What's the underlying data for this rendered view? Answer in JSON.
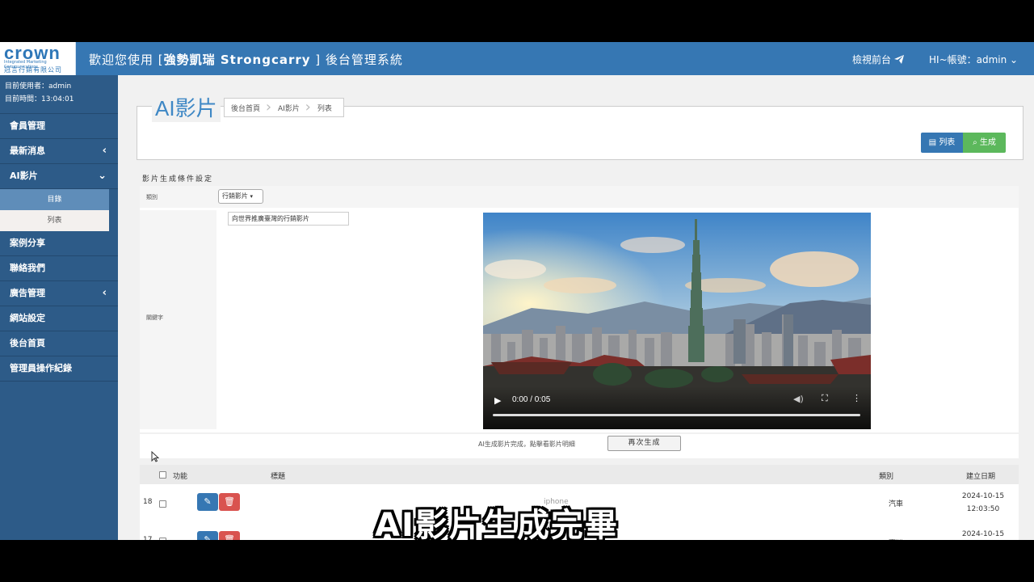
{
  "header": {
    "logo_text": "crown",
    "logo_sub_en": "Integrated Marketing Communications",
    "logo_sub_zh": "冠言行銷有限公司",
    "welcome_prefix": "歡迎您使用 [",
    "brand": "強勢凱瑞 Strongcarry",
    "welcome_suffix": " ] 後台管理系統",
    "view_front_label": "檢視前台",
    "account_label": "HI~帳號：admin",
    "accent_color": "#3677b3"
  },
  "sidebar": {
    "user_info": "目前使用者：admin",
    "time_info": "目前時間：13:04:01",
    "items": [
      {
        "label": "會員管理",
        "chevron": ""
      },
      {
        "label": "最新消息",
        "chevron": "‹"
      },
      {
        "label": "AI影片",
        "chevron": "⌄"
      },
      {
        "label": "案例分享",
        "chevron": ""
      },
      {
        "label": "聯絡我們",
        "chevron": ""
      },
      {
        "label": "廣告管理",
        "chevron": "‹"
      },
      {
        "label": "網站設定",
        "chevron": ""
      },
      {
        "label": "後台首頁",
        "chevron": ""
      },
      {
        "label": "管理員操作紀錄",
        "chevron": ""
      }
    ],
    "submenu": [
      {
        "label": "目錄"
      },
      {
        "label": "列表"
      }
    ],
    "collapse_icon": "‹"
  },
  "page": {
    "title": "AI影片",
    "breadcrumb": [
      "後台首頁",
      "AI影片",
      "列表"
    ],
    "btn_list": "列表",
    "btn_generate": "生成"
  },
  "form": {
    "section_title": "影片生成條件設定",
    "category_label": "類別",
    "category_value": "行銷影片",
    "keyword_label": "關鍵字",
    "keyword_value": "向世界推廣臺灣的行銷影片",
    "video_time": "0:00 / 0:05",
    "done_message": "AI生成影片完成，點擊看影片明細",
    "regenerate_label": "再次生成"
  },
  "table": {
    "headers": {
      "action": "功能",
      "title": "標題",
      "category": "類別",
      "created": "建立日期"
    },
    "rows": [
      {
        "id": "18",
        "title": "iphone",
        "category": "汽車",
        "date": "2024-10-15",
        "time": "12:03:50"
      },
      {
        "id": "17",
        "title": "",
        "category": "臺灣",
        "date": "2024-10-15",
        "time": ""
      }
    ]
  },
  "caption": "AI影片生成完畢"
}
